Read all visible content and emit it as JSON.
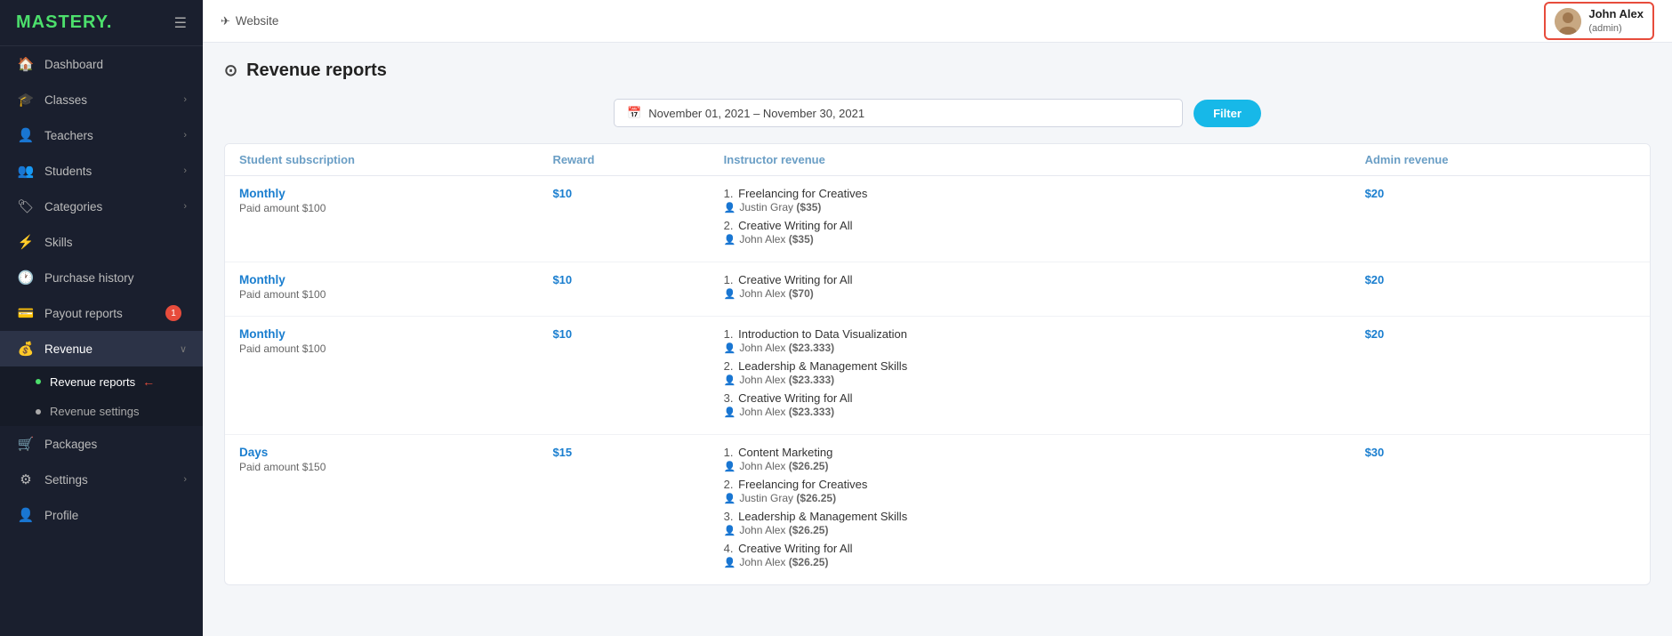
{
  "app": {
    "name": "MASTERY",
    "name_dot": "."
  },
  "topbar": {
    "website_label": "Website",
    "user_name": "John Alex",
    "user_role": "(admin)"
  },
  "sidebar": {
    "items": [
      {
        "id": "dashboard",
        "label": "Dashboard",
        "icon": "🏠",
        "has_arrow": false,
        "badge": null
      },
      {
        "id": "classes",
        "label": "Classes",
        "icon": "🎓",
        "has_arrow": true,
        "badge": null
      },
      {
        "id": "teachers",
        "label": "Teachers",
        "icon": "👤",
        "has_arrow": true,
        "badge": null
      },
      {
        "id": "students",
        "label": "Students",
        "icon": "👥",
        "has_arrow": true,
        "badge": null
      },
      {
        "id": "categories",
        "label": "Categories",
        "icon": "🏷",
        "has_arrow": true,
        "badge": null
      },
      {
        "id": "skills",
        "label": "Skills",
        "icon": "⚡",
        "has_arrow": false,
        "badge": null
      },
      {
        "id": "purchase-history",
        "label": "Purchase history",
        "icon": "🕐",
        "has_arrow": false,
        "badge": null
      },
      {
        "id": "payout-reports",
        "label": "Payout reports",
        "icon": "💳",
        "has_arrow": false,
        "badge": "1"
      },
      {
        "id": "revenue",
        "label": "Revenue",
        "icon": "💰",
        "has_arrow": true,
        "badge": null,
        "active": true
      }
    ],
    "sub_items": [
      {
        "id": "revenue-reports",
        "label": "Revenue reports",
        "active": true,
        "has_arrow_red": true
      },
      {
        "id": "revenue-settings",
        "label": "Revenue settings",
        "active": false,
        "has_arrow_red": false
      }
    ],
    "bottom_items": [
      {
        "id": "packages",
        "label": "Packages",
        "icon": "🛒",
        "has_arrow": false
      },
      {
        "id": "settings",
        "label": "Settings",
        "icon": "⚙",
        "has_arrow": true
      },
      {
        "id": "profile",
        "label": "Profile",
        "icon": "👤",
        "has_arrow": false
      }
    ]
  },
  "page": {
    "title": "Revenue reports",
    "date_range": "November 01, 2021 – November 30, 2021",
    "filter_btn": "Filter"
  },
  "table": {
    "headers": {
      "subscription": "Student subscription",
      "reward": "Reward",
      "instructor": "Instructor revenue",
      "admin": "Admin revenue"
    },
    "rows": [
      {
        "type": "Monthly",
        "paid_amount": "Paid amount $100",
        "reward": "$10",
        "admin": "$20",
        "instructors": [
          {
            "idx": "1.",
            "course": "Freelancing for Creatives",
            "instructor": "Justin Gray",
            "amount": "($35)"
          },
          {
            "idx": "2.",
            "course": "Creative Writing for All",
            "instructor": "John Alex",
            "amount": "($35)"
          }
        ]
      },
      {
        "type": "Monthly",
        "paid_amount": "Paid amount $100",
        "reward": "$10",
        "admin": "$20",
        "instructors": [
          {
            "idx": "1.",
            "course": "Creative Writing for All",
            "instructor": "John Alex",
            "amount": "($70)"
          }
        ]
      },
      {
        "type": "Monthly",
        "paid_amount": "Paid amount $100",
        "reward": "$10",
        "admin": "$20",
        "instructors": [
          {
            "idx": "1.",
            "course": "Introduction to Data Visualization",
            "instructor": "John Alex",
            "amount": "($23.333)"
          },
          {
            "idx": "2.",
            "course": "Leadership & Management Skills",
            "instructor": "John Alex",
            "amount": "($23.333)"
          },
          {
            "idx": "3.",
            "course": "Creative Writing for All",
            "instructor": "John Alex",
            "amount": "($23.333)"
          }
        ]
      },
      {
        "type": "Days",
        "paid_amount": "Paid amount $150",
        "reward": "$15",
        "admin": "$30",
        "instructors": [
          {
            "idx": "1.",
            "course": "Content Marketing",
            "instructor": "John Alex",
            "amount": "($26.25)"
          },
          {
            "idx": "2.",
            "course": "Freelancing for Creatives",
            "instructor": "Justin Gray",
            "amount": "($26.25)"
          },
          {
            "idx": "3.",
            "course": "Leadership & Management Skills",
            "instructor": "John Alex",
            "amount": "($26.25)"
          },
          {
            "idx": "4.",
            "course": "Creative Writing for All",
            "instructor": "John Alex",
            "amount": "($26.25)"
          }
        ]
      }
    ]
  }
}
